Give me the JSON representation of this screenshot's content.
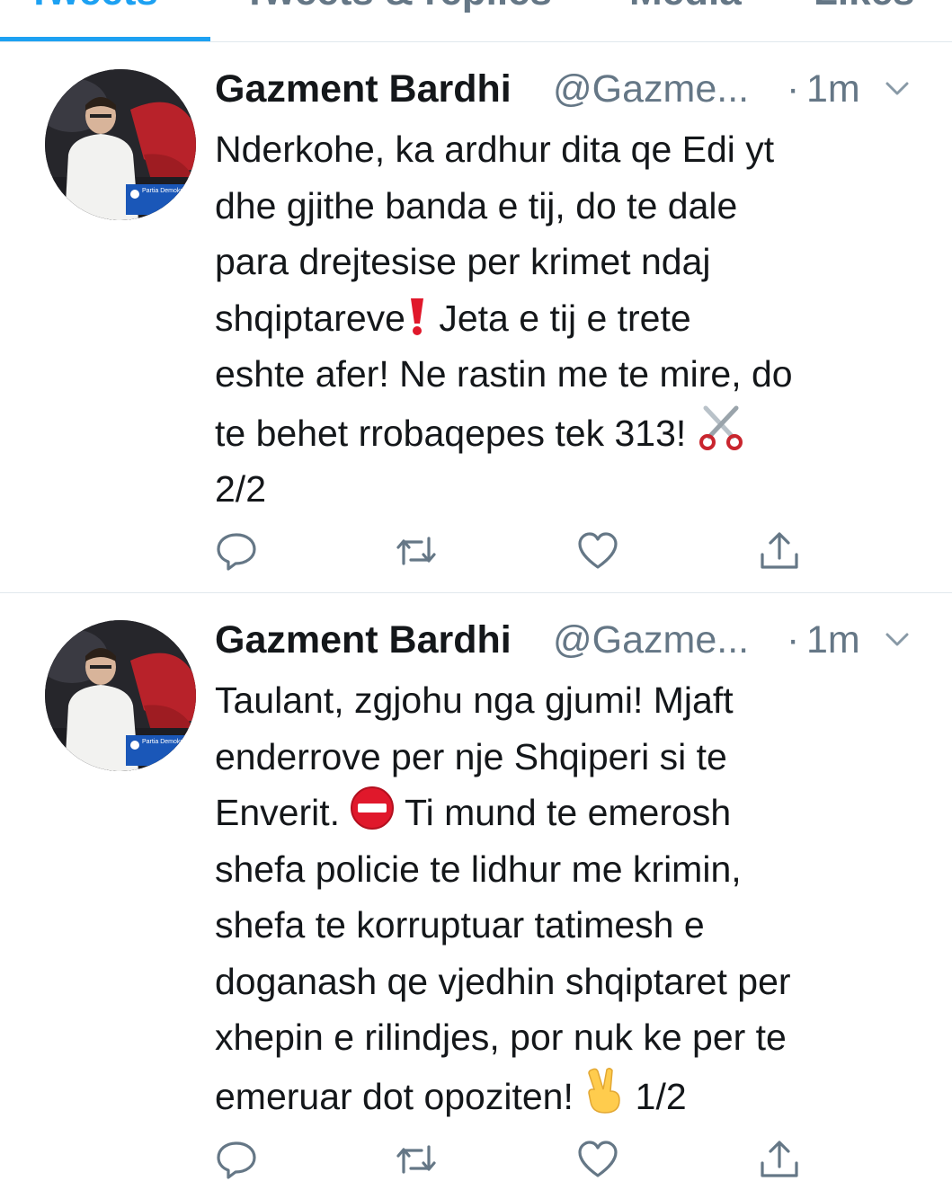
{
  "tabs": [
    {
      "label": "Tweets",
      "active": true
    },
    {
      "label": "Tweets & replies",
      "active": false
    },
    {
      "label": "Media",
      "active": false
    },
    {
      "label": "Likes",
      "active": false
    }
  ],
  "colors": {
    "accent": "#1da1f2",
    "text": "#14171a",
    "secondary": "#657786",
    "divider": "#e1e8ed"
  },
  "tweets": [
    {
      "name": "Gazment Bardhi",
      "handle": "@Gazme...",
      "dot": "·",
      "time": "1m",
      "text_a": "Nderkohe, ka ardhur dita qe Edi yt\ndhe gjithe banda e tij, do te dale\npara drejtesise per krimet ndaj\nshqiptareve",
      "text_b": " Jeta e tij e trete\neshte afer! Ne rastin me te mire, do\nte behet rrobaqepes tek 313! ",
      "text_c": "\n2/2",
      "emoji_1": "exclamation-mark-emoji",
      "emoji_2": "scissors-emoji",
      "avatar_badge": "Partia Demokratike",
      "icons": [
        "reply-icon",
        "retweet-icon",
        "like-icon",
        "share-icon"
      ]
    },
    {
      "name": "Gazment Bardhi",
      "handle": "@Gazme...",
      "dot": "·",
      "time": "1m",
      "text_a": "Taulant, zgjohu nga gjumi! Mjaft\nenderrove per nje Shqiperi si te\nEnverit. ",
      "text_b": " Ti mund te emerosh\nshefa policie te lidhur me krimin,\nshefa te korruptuar tatimesh e\ndoganash qe vjedhin shqiptaret per\nxhepin e rilindjes, por nuk ke per te\nemeruar dot opoziten! ",
      "text_c": " 1/2",
      "emoji_1": "no-entry-emoji",
      "emoji_2": "victory-hand-emoji",
      "avatar_badge": "Partia Demokratike",
      "icons": [
        "reply-icon",
        "retweet-icon",
        "like-icon",
        "share-icon"
      ]
    }
  ]
}
